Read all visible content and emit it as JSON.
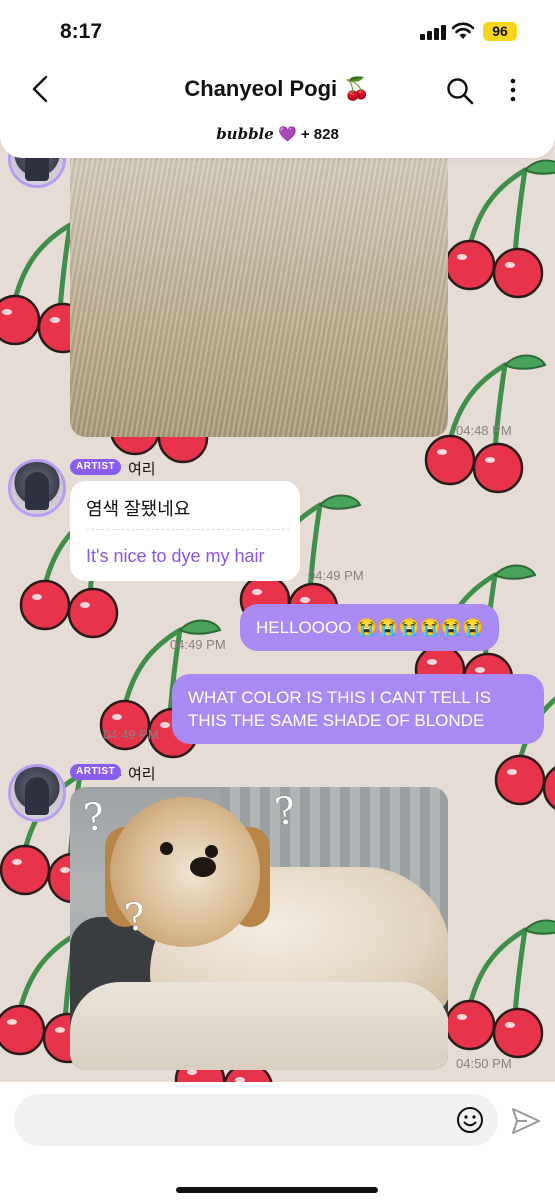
{
  "status_bar": {
    "time": "8:17",
    "battery": "96",
    "icons": [
      "signal-icon",
      "wifi-icon",
      "battery-icon"
    ]
  },
  "header": {
    "title": "Chanyeol Pogi 🍒",
    "subtitle_brand": "bubble",
    "subtitle_heart": "💜",
    "subtitle_count": "+ 828",
    "icons": [
      "back-arrow-icon",
      "search-icon",
      "more-vertical-icon"
    ]
  },
  "messages": {
    "photo1_time": "04:48 PM",
    "artist_badge": "ARTIST",
    "artist_name": "여리",
    "translated_korean": "염색 잘됐네요",
    "translated_english": "It's nice to dye my hair",
    "translated_time": "04:49 PM",
    "sent1_time": "04:49 PM",
    "sent1_text": "HELLOOOO 😭😭😭😭😭😭",
    "sent2_time": "04:49 PM",
    "sent2_text": "WHAT COLOR IS THIS I CANT TELL IS THIS THE SAME SHADE OF BLONDE",
    "artist_badge_2": "ARTIST",
    "artist_name_2": "여리",
    "photo2_time": "04:50 PM",
    "photo2_marks": [
      "?",
      "?",
      "?"
    ]
  },
  "input": {
    "placeholder": "",
    "icons": [
      "emoji-icon",
      "send-icon"
    ]
  },
  "colors": {
    "accent": "#a98af2",
    "badge": "#8a5cf0",
    "translation_text": "#8b56e6",
    "background": "#e6dcd6",
    "battery": "#f7d51c",
    "cherry": "#e8344a"
  }
}
